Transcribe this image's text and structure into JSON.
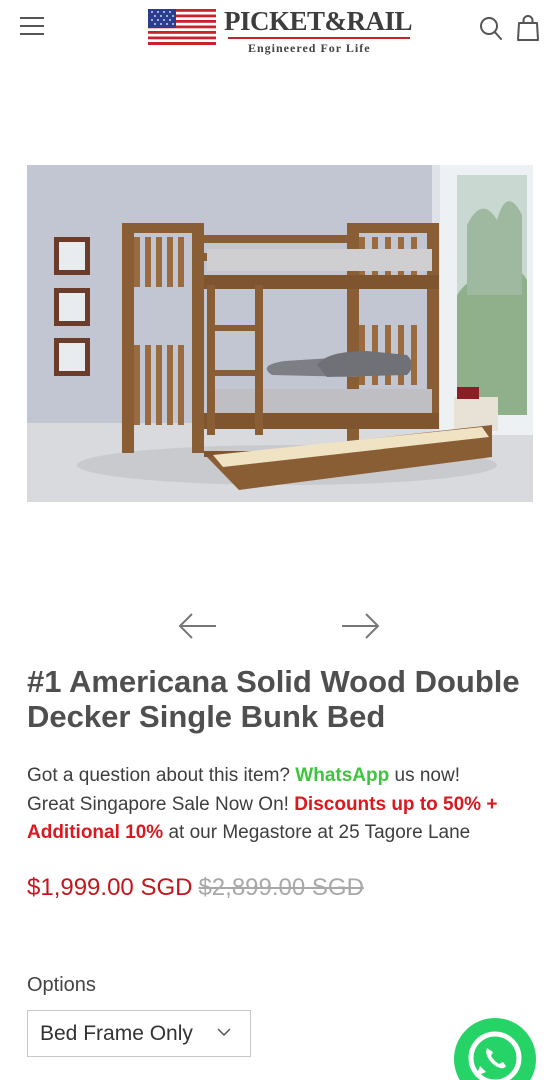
{
  "header": {
    "menu_icon": "hamburger-menu-icon",
    "logo_flag_icon": "us-flag-icon",
    "brand_name": "PICKET&RAIL",
    "brand_tagline": "Engineered For Life",
    "search_icon": "search-icon",
    "cart_icon": "shopping-bag-icon"
  },
  "gallery": {
    "image_subject": "wooden-bunk-bed-photo",
    "prev_icon": "arrow-left-icon",
    "next_icon": "arrow-right-icon"
  },
  "product": {
    "title": "#1 Americana Solid Wood Double Decker Single Bunk Bed",
    "promo": {
      "question_prefix": "Got a question about this item? ",
      "whatsapp_link": "WhatsApp",
      "question_suffix": " us now!",
      "sale_prefix": "Great Singapore Sale Now On! ",
      "discount_text": "Discounts up to 50% + Additional 10%",
      "sale_suffix": " at our Megastore at 25 Tagore Lane"
    },
    "price": "$1,999.00 SGD",
    "compare_price": "$2,899.00 SGD"
  },
  "options": {
    "label": "Options",
    "selected": "Bed Frame Only",
    "chevron_icon": "chevron-down-icon"
  },
  "floating": {
    "whatsapp_icon": "whatsapp-icon"
  },
  "colors": {
    "accent_red": "#d71920",
    "whatsapp_green": "#3ec53e",
    "price_red": "#c4161c"
  }
}
